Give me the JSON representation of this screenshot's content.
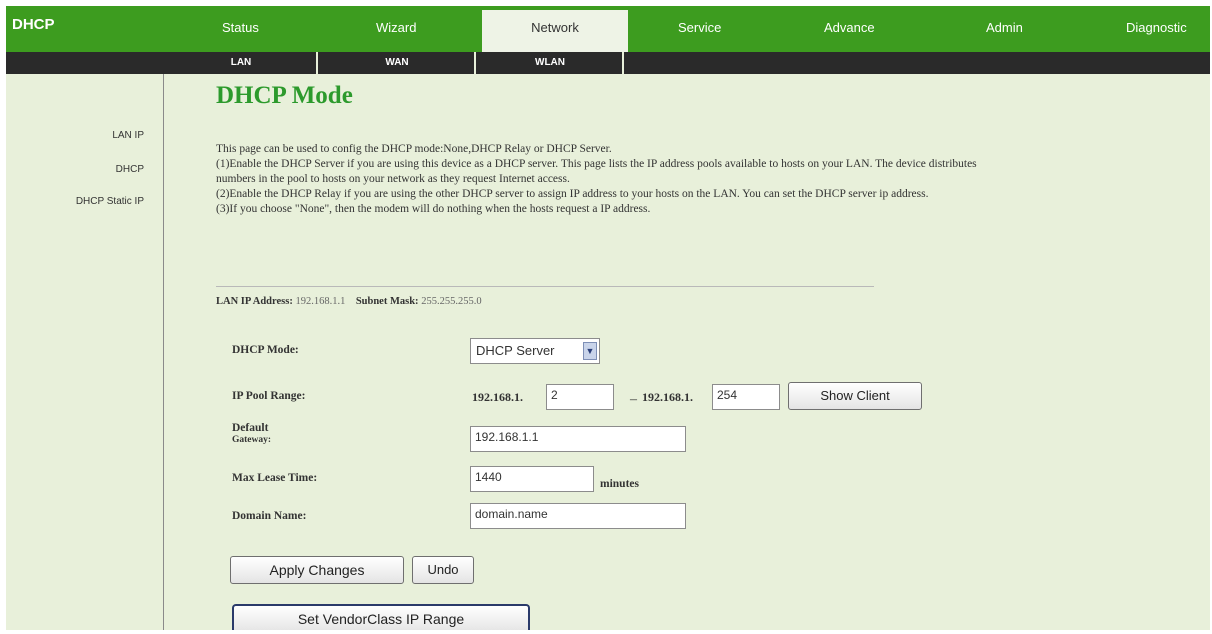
{
  "header": {
    "brand": "DHCP",
    "tabs": [
      {
        "label": "Status"
      },
      {
        "label": "Wizard"
      },
      {
        "label": "Network",
        "active": true
      },
      {
        "label": "Service"
      },
      {
        "label": "Advance"
      },
      {
        "label": "Admin"
      },
      {
        "label": "Diagnostic"
      }
    ],
    "subtabs": [
      "LAN",
      "WAN",
      "WLAN"
    ]
  },
  "sidebar": {
    "items": [
      "LAN IP",
      "DHCP",
      "DHCP Static IP"
    ]
  },
  "main": {
    "title": "DHCP Mode",
    "description": [
      "This page can be used to config the DHCP mode:None,DHCP Relay or DHCP Server.",
      "(1)Enable the DHCP Server if you are using this device as a DHCP server. This page lists the IP address pools available to hosts on your LAN. The device distributes numbers in the pool to hosts on your network as they request Internet access.",
      "(2)Enable the DHCP Relay if you are using the other DHCP server to assign IP address to your hosts on the LAN. You can set the DHCP server ip address.",
      "(3)If you choose \"None\", then the modem will do nothing when the hosts request a IP address."
    ],
    "lan_ip_label": "LAN IP Address:",
    "lan_ip_value": "192.168.1.1",
    "subnet_label": "Subnet Mask:",
    "subnet_value": "255.255.255.0"
  },
  "form": {
    "dhcp_mode_label": "DHCP Mode:",
    "dhcp_mode_value": "DHCP Server",
    "ip_pool_label": "IP Pool Range:",
    "pool_prefix": "192.168.1.",
    "pool_start": "2",
    "pool_dash": "–",
    "pool_end": "254",
    "show_client_label": "Show Client",
    "gateway_label_1": "Default",
    "gateway_label_2": "Gateway:",
    "gateway_value": "192.168.1.1",
    "lease_label": "Max Lease Time:",
    "lease_value": "1440",
    "lease_unit": "minutes",
    "domain_label": "Domain Name:",
    "domain_value": "domain.name"
  },
  "buttons": {
    "apply": "Apply Changes",
    "undo": "Undo",
    "vendor": "Set VendorClass IP Range"
  },
  "colors": {
    "header_green": "#3d9c1f",
    "title_green": "#2c9a2c",
    "page_bg": "#e8f0da",
    "subbar": "#2a2a2a"
  }
}
